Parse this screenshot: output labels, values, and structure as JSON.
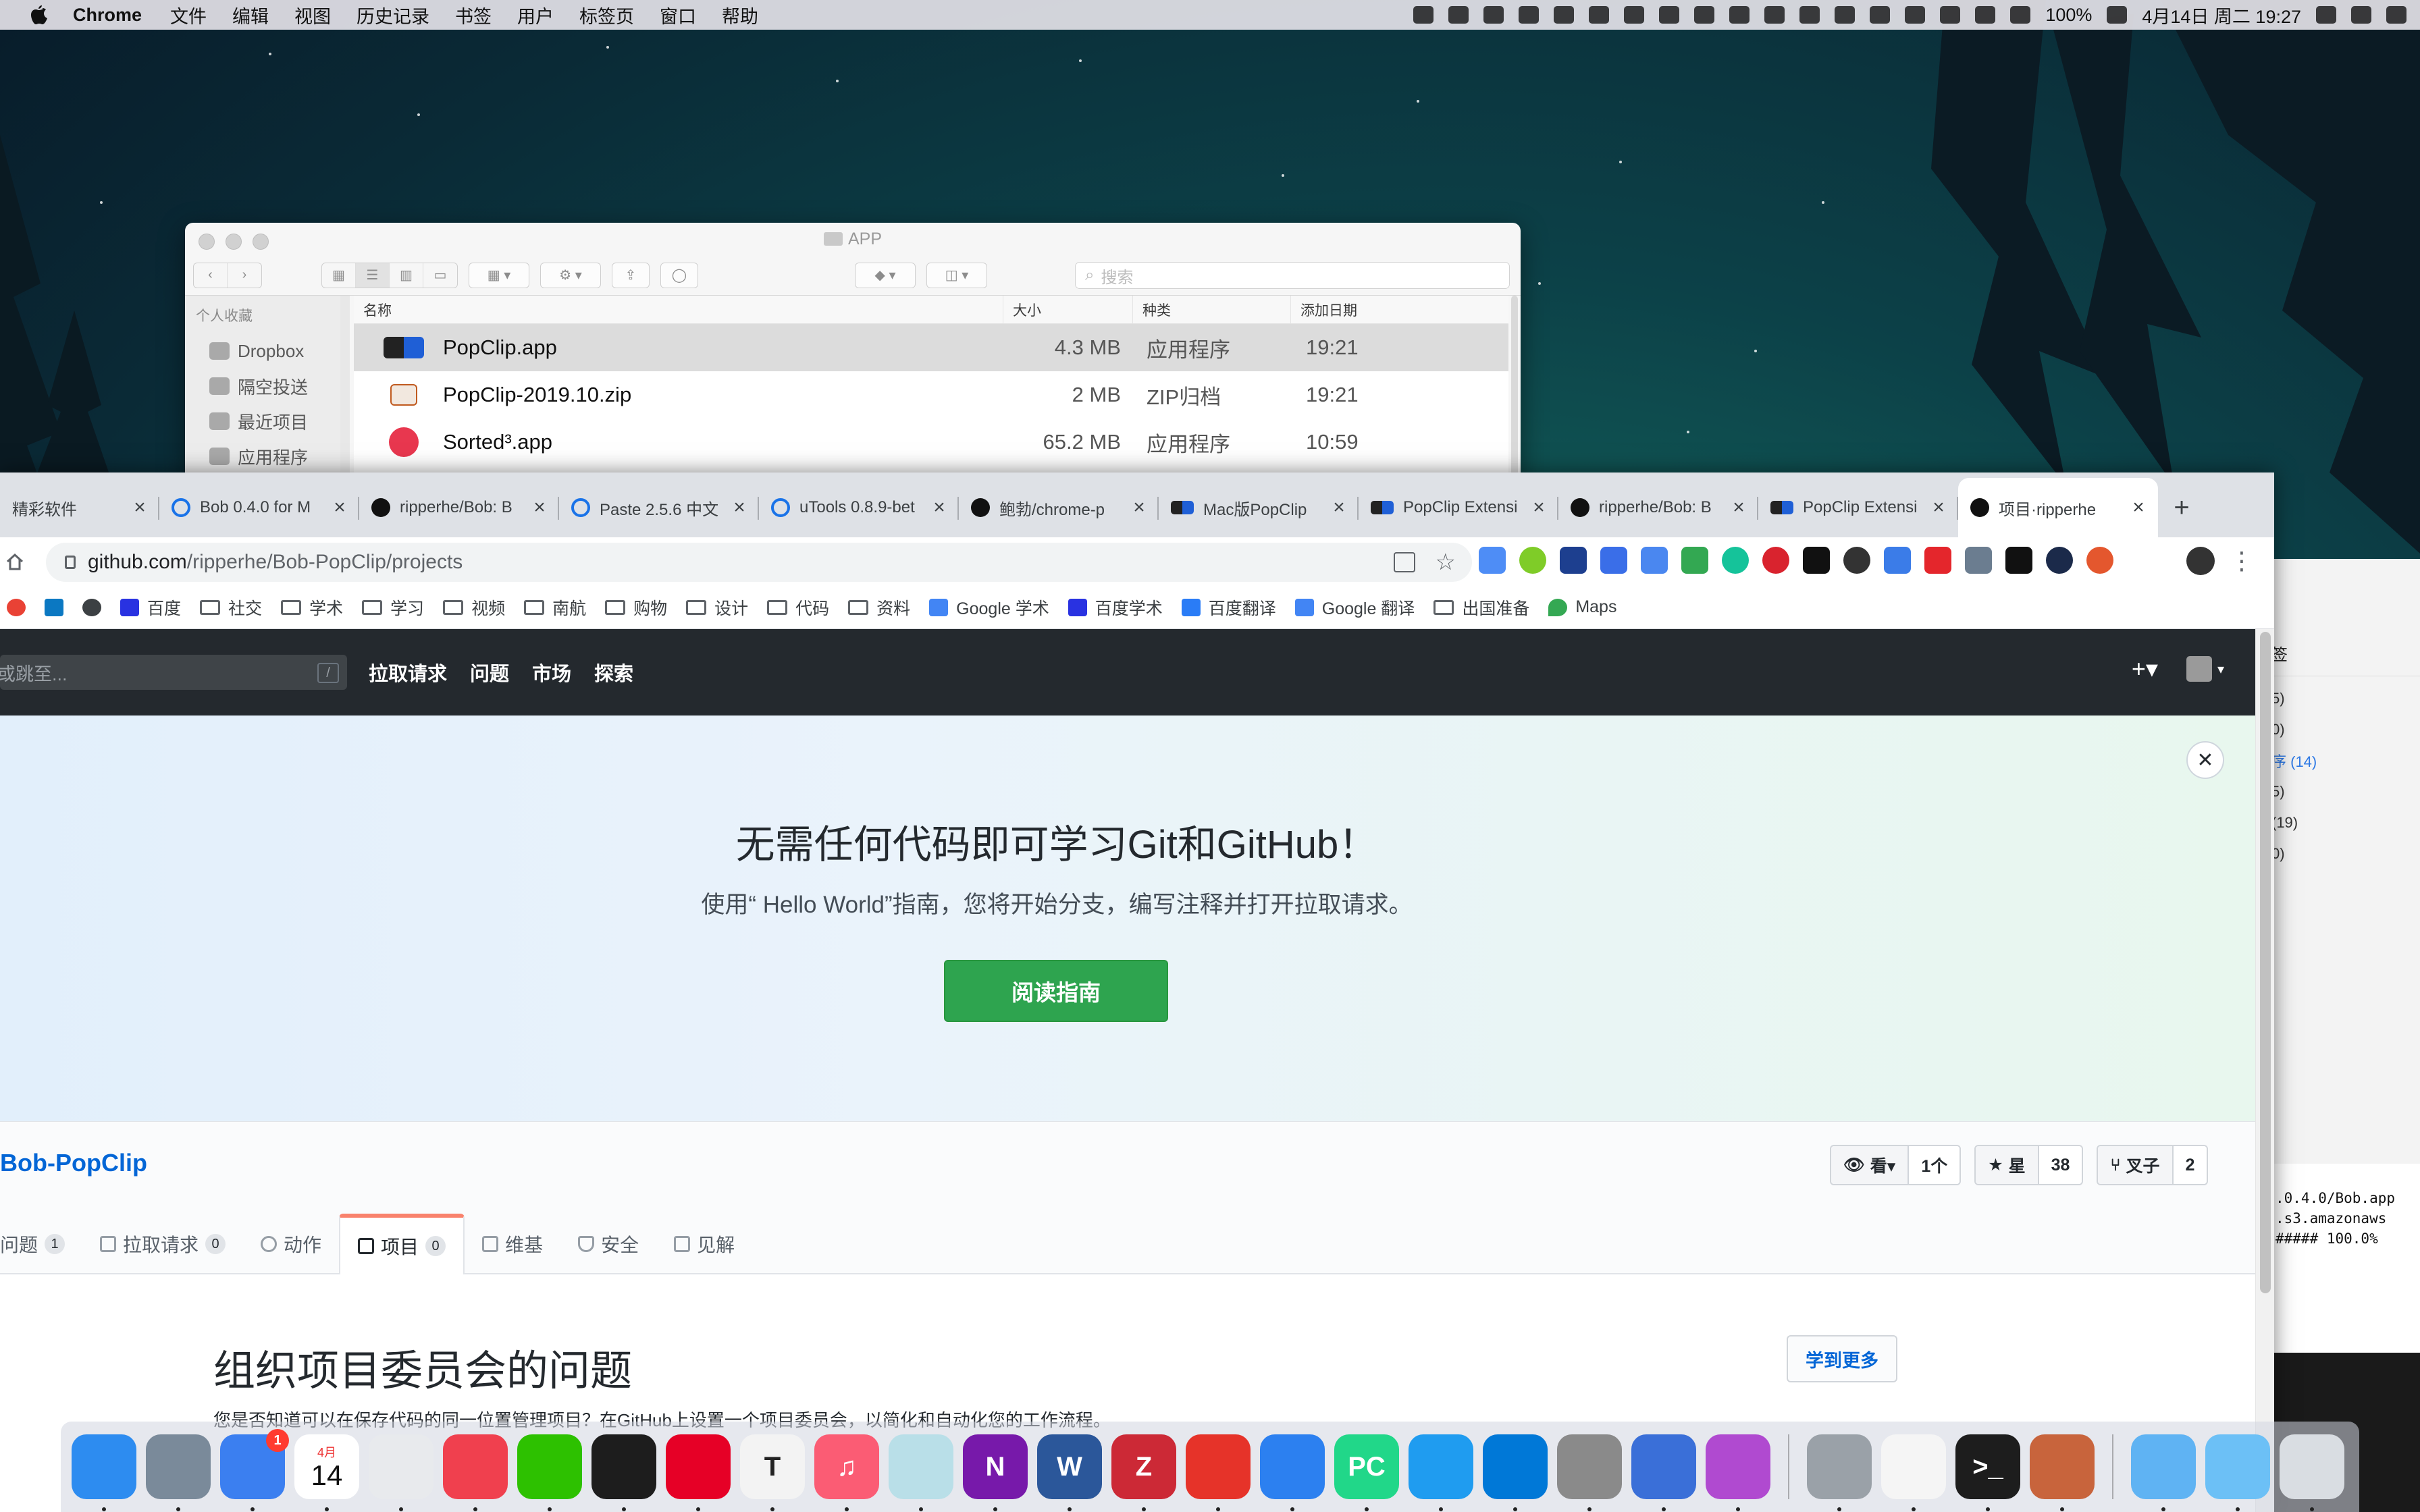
{
  "menubar": {
    "app_name": "Chrome",
    "menus": [
      "文件",
      "编辑",
      "视图",
      "历史记录",
      "书签",
      "用户",
      "标签页",
      "窗口",
      "帮助"
    ],
    "battery": "100%",
    "datetime": "4月14日 周二  19:27"
  },
  "finder": {
    "title": "APP",
    "search_placeholder": "搜索",
    "sidebar_heading": "个人收藏",
    "sidebar_items": [
      "Dropbox",
      "隔空投送",
      "最近项目",
      "应用程序"
    ],
    "columns": {
      "name": "名称",
      "size": "大小",
      "kind": "种类",
      "date": "添加日期"
    },
    "files": [
      {
        "name": "PopClip.app",
        "size": "4.3 MB",
        "kind": "应用程序",
        "date": "19:21",
        "icon_color": "#1f5fd6"
      },
      {
        "name": "PopClip-2019.10.zip",
        "size": "2 MB",
        "kind": "ZIP归档",
        "date": "19:21",
        "icon_color": "#c05a1f"
      },
      {
        "name": "Sorted³.app",
        "size": "65.2 MB",
        "kind": "应用程序",
        "date": "10:59",
        "icon_color": "#e8374f"
      }
    ]
  },
  "background_window": {
    "heading": "签",
    "lines": [
      "5)",
      "0)",
      "序 (14)",
      "5)",
      "(19)",
      "0)"
    ]
  },
  "terminal": {
    "lines": [
      ".0.4.0/Bob.app",
      ".s3.amazonaws",
      "##### 100.0%"
    ]
  },
  "chrome": {
    "tabs": [
      {
        "label": "精彩软件",
        "fav_color": "#b0b0b0"
      },
      {
        "label": "Bob 0.4.0 for M",
        "fav_color": "#1a73e8"
      },
      {
        "label": "ripperhe/Bob: B",
        "fav_color": "#111111"
      },
      {
        "label": "Paste 2.5.6 中文",
        "fav_color": "#1a73e8"
      },
      {
        "label": "uTools 0.8.9-bet",
        "fav_color": "#1a73e8"
      },
      {
        "label": "鲍勃/chrome-p",
        "fav_color": "#111111"
      },
      {
        "label": "Mac版PopClip",
        "fav_color": "#1f5fd6"
      },
      {
        "label": "PopClip Extensi",
        "fav_color": "#1f5fd6"
      },
      {
        "label": "ripperhe/Bob: B",
        "fav_color": "#111111"
      },
      {
        "label": "PopClip Extensi",
        "fav_color": "#1f5fd6"
      },
      {
        "label": "项目·ripperhe",
        "fav_color": "#111111",
        "active": true
      }
    ],
    "new_tab": "+",
    "url_host": "github.com",
    "url_path": "/ripperhe/Bob-PopClip/projects",
    "bookmarks": [
      {
        "label": "",
        "type": "icon",
        "color": "#1a73e8"
      },
      {
        "label": "",
        "type": "icon",
        "color": "#0b78c2"
      },
      {
        "label": "",
        "type": "icon",
        "color": "#3c4043"
      },
      {
        "label": "百度",
        "type": "icon",
        "color": "#2932e1"
      },
      {
        "label": "社交",
        "type": "folder"
      },
      {
        "label": "学术",
        "type": "folder"
      },
      {
        "label": "学习",
        "type": "folder"
      },
      {
        "label": "视频",
        "type": "folder"
      },
      {
        "label": "南航",
        "type": "folder"
      },
      {
        "label": "购物",
        "type": "folder"
      },
      {
        "label": "设计",
        "type": "folder"
      },
      {
        "label": "代码",
        "type": "folder"
      },
      {
        "label": "资料",
        "type": "folder"
      },
      {
        "label": "Google 学术",
        "type": "icon",
        "color": "#4285f4"
      },
      {
        "label": "百度学术",
        "type": "icon",
        "color": "#2932e1"
      },
      {
        "label": "百度翻译",
        "type": "icon",
        "color": "#2a7cf6"
      },
      {
        "label": "Google 翻译",
        "type": "icon",
        "color": "#4285f4"
      },
      {
        "label": "出国准备",
        "type": "folder"
      },
      {
        "label": "Maps",
        "type": "icon",
        "color": "#34a853"
      }
    ]
  },
  "github": {
    "search_placeholder": "或跳至...",
    "search_key": "/",
    "nav": [
      "拉取请求",
      "问题",
      "市场",
      "探索"
    ],
    "plus": "+▾",
    "hero_title": "无需任何代码即可学习Git和GitHub！",
    "hero_subtitle": "使用“ Hello World”指南，您将开始分支，编写注释并打开拉取请求。",
    "hero_button": "阅读指南",
    "hero_close": "✕",
    "repo_name": "Bob-PopClip",
    "watch_label": "看▾",
    "watch_count": "1个",
    "star_label": "星",
    "star_count": "38",
    "fork_label": "叉子",
    "fork_count": "2",
    "tabs": [
      {
        "label": "问题",
        "count": "1"
      },
      {
        "label": "拉取请求",
        "count": "0"
      },
      {
        "label": "动作",
        "count": ""
      },
      {
        "label": "项目",
        "count": "0",
        "active": true
      },
      {
        "label": "维基",
        "count": ""
      },
      {
        "label": "安全",
        "count": ""
      },
      {
        "label": "见解",
        "count": ""
      }
    ],
    "section_title": "组织项目委员会的问题",
    "section_text": "您是否知道可以在保存代码的同一位置管理项目？在GitHub上设置一个项目委员会，以简化和自动化您的工作流程。",
    "learn_more": "学到更多"
  },
  "dock": {
    "calendar_month": "4月",
    "calendar_day": "14",
    "launchpad_badge": "1",
    "icons": [
      {
        "name": "finder-icon",
        "color": "#2d8cf0",
        "glyph": ""
      },
      {
        "name": "launchpad-icon",
        "color": "#7a8a9a",
        "glyph": ""
      },
      {
        "name": "spark-icon",
        "color": "#3b7ff0",
        "glyph": "",
        "badge": true
      },
      {
        "name": "calendar-icon",
        "color": "#ffffff",
        "glyph": "cal"
      },
      {
        "name": "chrome-icon",
        "color": "#e8eaed",
        "glyph": ""
      },
      {
        "name": "ticktick-icon",
        "color": "#f0404e",
        "glyph": ""
      },
      {
        "name": "wechat-icon",
        "color": "#2dc100",
        "glyph": ""
      },
      {
        "name": "qq-icon",
        "color": "#1d1d1d",
        "glyph": ""
      },
      {
        "name": "netease-music-icon",
        "color": "#e60026",
        "glyph": ""
      },
      {
        "name": "typora-icon",
        "color": "#f3f3f3",
        "glyph": "T"
      },
      {
        "name": "music-icon",
        "color": "#fb5c74",
        "glyph": "♫"
      },
      {
        "name": "keyboard-icon",
        "color": "#b9dfe8",
        "glyph": ""
      },
      {
        "name": "onenote-icon",
        "color": "#7719aa",
        "glyph": "N"
      },
      {
        "name": "word-icon",
        "color": "#2b579a",
        "glyph": "W"
      },
      {
        "name": "zotero-icon",
        "color": "#cc2936",
        "glyph": "Z"
      },
      {
        "name": "pdf-expert-icon",
        "color": "#e63329",
        "glyph": ""
      },
      {
        "name": "maps-pin-icon",
        "color": "#2c80f0",
        "glyph": ""
      },
      {
        "name": "pycharm-icon",
        "color": "#21d789",
        "glyph": "PC"
      },
      {
        "name": "vscode-icon",
        "color": "#1f9cf0",
        "glyph": ""
      },
      {
        "name": "windows-icon",
        "color": "#0078d7",
        "glyph": ""
      },
      {
        "name": "system-preferences-icon",
        "color": "#8a8a8a",
        "glyph": ""
      },
      {
        "name": "rocket-icon",
        "color": "#3a6fd8",
        "glyph": ""
      },
      {
        "name": "flower-icon",
        "color": "#b04ad0",
        "glyph": ""
      },
      {
        "name": "separator",
        "color": "",
        "glyph": ""
      },
      {
        "name": "installer-icon",
        "color": "#9aa1a8",
        "glyph": ""
      },
      {
        "name": "textedit-icon",
        "color": "#f5f5f5",
        "glyph": ""
      },
      {
        "name": "terminal-icon",
        "color": "#1d1d1d",
        "glyph": ">_"
      },
      {
        "name": "popclip-ball-icon",
        "color": "#c8643c",
        "glyph": ""
      },
      {
        "name": "separator",
        "color": "",
        "glyph": ""
      },
      {
        "name": "downloads-folder-icon",
        "color": "#5fb3f3",
        "glyph": ""
      },
      {
        "name": "folder-icon",
        "color": "#6cc0f6",
        "glyph": ""
      },
      {
        "name": "trash-icon",
        "color": "#d9dde2",
        "glyph": ""
      }
    ]
  }
}
